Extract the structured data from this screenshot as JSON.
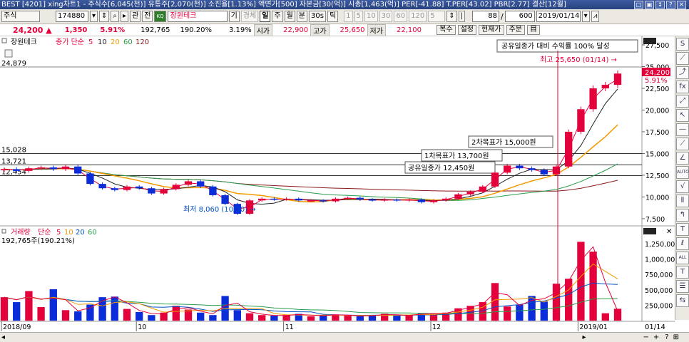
{
  "window": {
    "title": "BEST [4201] xing차트1 - 주식수[6,045(천)] 유통주[2,070(천)] 소진율[1.13%] 액면가[500] 자본금[30(억)] 시총[1,463(억)] PER[-41.88] T.PER[43.02] PBR[2.77] 결산[12월]",
    "controls": [
      "□",
      "▣",
      "↕",
      "?",
      "✕"
    ]
  },
  "toolbar": {
    "mode": "주식",
    "code": "174880",
    "search_btn": "관",
    "all_btn": "전",
    "stock_name": "장원테크",
    "period_btns": [
      "기",
      "경체",
      "일",
      "주",
      "월",
      "분",
      "30s",
      "틱"
    ],
    "active_period": "일",
    "interval_btns": [
      "1",
      "5",
      "10",
      "30",
      "60",
      "120",
      "5"
    ],
    "count_value": "88",
    "total_value": "600",
    "date_value": "2019/01/14"
  },
  "quote": {
    "price": "24,200 ▲",
    "change": "1,350",
    "rate": "5.91%",
    "volume": "192,765",
    "vol_rate": "190.20%",
    "turnover": "3.19%",
    "open_label": "시가",
    "open": "22,900",
    "high_label": "고가",
    "high": "25,650",
    "low_label": "저가",
    "low": "22,100",
    "buttons": [
      "복수",
      "설정",
      "현재가",
      "주문",
      "目"
    ]
  },
  "price_panel": {
    "legend_name": "장원테크",
    "legend_ma_label": "종가 단순",
    "legend_ma": [
      "5",
      "10",
      "20",
      "60",
      "120"
    ],
    "legend_ma_colors": [
      "#e4003a",
      "#222222",
      "#f59a00",
      "#2a9d4a",
      "#8b1a1a"
    ],
    "top_label": "24,879",
    "left_marks": [
      "15,028",
      "13,721",
      "12,454"
    ],
    "hline_labels": [
      "2차목표가 15,000원",
      "1차목표가 13,700원",
      "공유일종가 12,450원"
    ],
    "banner": "공유일종가 대비 수익률 100% 달성",
    "high_annot": "최고 25,650 (01/14) →",
    "low_annot": "최저 8,060 (10/30) →",
    "current_price_tag": "24,200",
    "current_rate_tag": "5.91%",
    "axis_labels": [
      "27,500",
      "25,000",
      "22,500",
      "20,000",
      "17,500",
      "15,000",
      "12,500",
      "10,000",
      "7,500"
    ]
  },
  "volume_panel": {
    "legend_name": "거래량",
    "legend_ma_label": "단순",
    "legend_ma": [
      "5",
      "10",
      "20",
      "60"
    ],
    "legend_ma_colors": [
      "#e4003a",
      "#f59a00",
      "#0050c8",
      "#2a9d4a"
    ],
    "value_label": "192,765주(190.21%)",
    "axis_labels": [
      "1,250,000",
      "1,000,000",
      "750,000",
      "500,000",
      "250,000"
    ]
  },
  "x_axis": {
    "labels": [
      "2018/09",
      "10",
      "11",
      "12",
      "2019/01"
    ],
    "end_label": "01/14"
  },
  "right_tools": [
    "S",
    "⟋",
    "⤴",
    "fx",
    "⤢",
    "↖",
    "—",
    "⟋",
    "∠",
    "AUTO",
    "√",
    "⦀",
    "↰",
    "T",
    "ℓ",
    "ALL",
    "T",
    "☰",
    "⇆"
  ],
  "colors": {
    "up": "#e4003a",
    "down": "#0a2cd9",
    "ma5": "#e4003a",
    "ma10": "#222222",
    "ma20": "#f59a00",
    "ma60": "#2a9d4a",
    "ma120": "#8b1a1a"
  },
  "chart_data": {
    "type": "candlestick",
    "title": "장원테크",
    "x": [
      "2018/09",
      "10",
      "11",
      "12",
      "2019/01",
      "01/14"
    ],
    "ylim": [
      7000,
      27500
    ],
    "hlines": [
      15000,
      13700,
      12450
    ],
    "series": [
      {
        "name": "종가",
        "values": [
          13200,
          13000,
          13300,
          13400,
          13200,
          13500,
          12700,
          11500,
          11000,
          10800,
          11200,
          11000,
          10400,
          10900,
          11400,
          11800,
          11200,
          10200,
          9200,
          8060,
          9600,
          9800,
          9700,
          9800,
          9600,
          9600,
          9500,
          9800,
          9900,
          9700,
          9600,
          9700,
          9600,
          9700,
          9400,
          9600,
          9800,
          10300,
          10600,
          11200,
          12800,
          13600,
          13300,
          13100,
          12600,
          13500,
          17500,
          20100,
          22500,
          22900,
          24200
        ]
      },
      {
        "name": "거래량",
        "values": [
          380000,
          300000,
          480000,
          220000,
          510000,
          170000,
          150000,
          260000,
          380000,
          390000,
          190000,
          140000,
          90000,
          130000,
          240000,
          180000,
          130000,
          90000,
          400000,
          170000,
          120000,
          90000,
          80000,
          90000,
          110000,
          70000,
          90000,
          100000,
          80000,
          70000,
          90000,
          110000,
          80000,
          90000,
          120000,
          110000,
          130000,
          200000,
          240000,
          300000,
          610000,
          230000,
          260000,
          400000,
          310000,
          600000,
          680000,
          1280000,
          1120000,
          120000,
          192765
        ]
      }
    ]
  }
}
